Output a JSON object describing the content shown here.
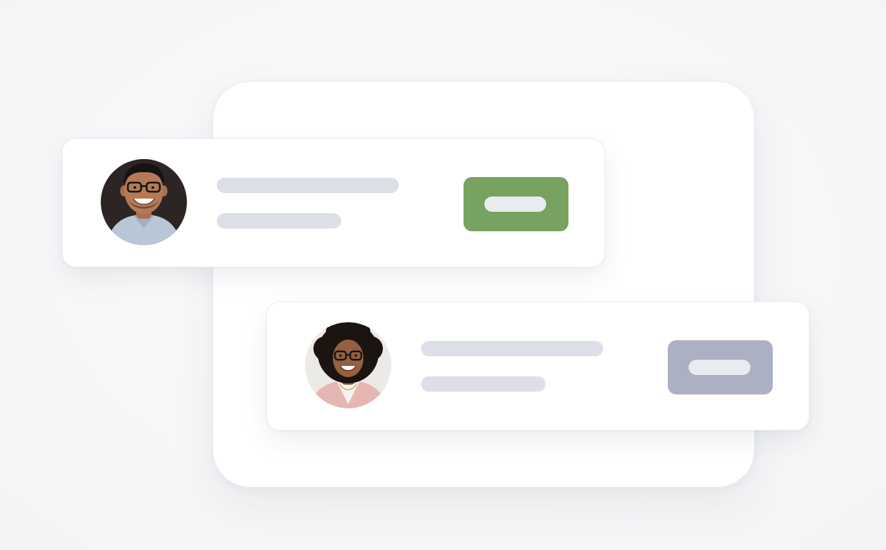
{
  "colors": {
    "background": "#f6f7f8",
    "panel": "#ffffff",
    "card_border": "#e6ebf6",
    "placeholder_line": "#dcdfe7",
    "accept_button": "#77a25f",
    "inactive_button": "#acb0c3",
    "button_pill": "#e9ecef"
  },
  "cards": [
    {
      "avatar": "avatar-man-glasses",
      "button_state": "active",
      "button_color": "#77a25f"
    },
    {
      "avatar": "avatar-woman-curly-hair",
      "button_state": "inactive",
      "button_color": "#acb0c3"
    }
  ]
}
